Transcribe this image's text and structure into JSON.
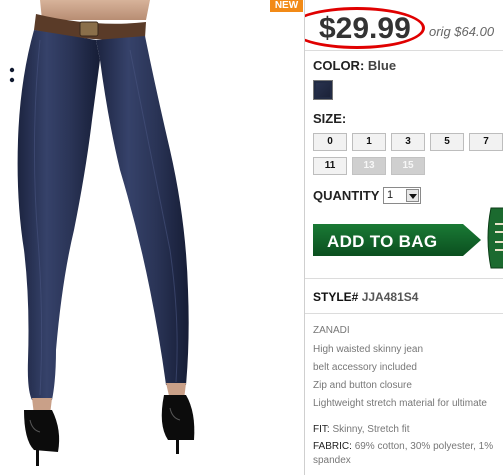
{
  "badge": "NEW",
  "price": {
    "current": "$29.99",
    "original": "orig $64.00"
  },
  "color": {
    "label": "COLOR:",
    "value": "Blue",
    "swatch_color": "#222b44"
  },
  "size": {
    "label": "SIZE:",
    "options": [
      {
        "label": "0",
        "available": true
      },
      {
        "label": "1",
        "available": true
      },
      {
        "label": "3",
        "available": true
      },
      {
        "label": "5",
        "available": true
      },
      {
        "label": "7",
        "available": true
      },
      {
        "label": "11",
        "available": true
      },
      {
        "label": "13",
        "available": false
      },
      {
        "label": "15",
        "available": false
      }
    ]
  },
  "quantity": {
    "label": "QUANTITY",
    "value": "1"
  },
  "add_to_bag": {
    "label": "ADD TO BAG",
    "color": "#0e5e26"
  },
  "style": {
    "label": "STYLE#",
    "value": "JJA481S4"
  },
  "description": [
    "ZANADI",
    "High waisted skinny jean",
    "belt accessory included",
    "Zip and button closure",
    "Lightweight stretch material for ultimate"
  ],
  "fit": {
    "label": "FIT:",
    "value": "Skinny, Stretch fit"
  },
  "fabric": {
    "label": "FABRIC:",
    "value": "69% cotton, 30% polyester, 1%",
    "value_line2": "spandex"
  },
  "colors": {
    "price_circle": "#e00000",
    "badge": "#f28a16",
    "denim": "#2b3553"
  }
}
